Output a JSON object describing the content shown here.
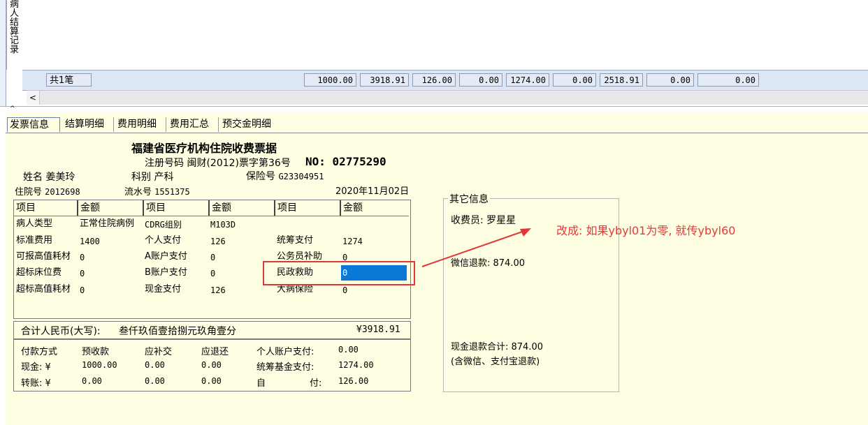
{
  "top_grid": {
    "side_label": "病人结算记录",
    "summary": {
      "count": "共1笔",
      "values": [
        "1000.00",
        "3918.91",
        "126.00",
        "0.00",
        "1274.00",
        "0.00",
        "2518.91",
        "0.00",
        "0.00"
      ]
    },
    "scroll_left_glyph": "<",
    "splitter_glyph": "^"
  },
  "tabs": [
    "发票信息",
    "结算明细",
    "费用明细",
    "费用汇总",
    "预交金明细"
  ],
  "receipt": {
    "title": "福建省医疗机构住院收费票据",
    "reg_line": "注册号码 闽财(2012)票字第36号",
    "no_label": "NO:",
    "no_value": "02775290",
    "name_label": "姓名",
    "name_value": "姜美玲",
    "dept_label": "科别",
    "dept_value": "产科",
    "insurance_label": "保险号",
    "insurance_value": "G23304951",
    "admission_label": "住院号",
    "admission_value": "2012698",
    "serial_label": "流水号",
    "serial_value": "1551375",
    "date": "2020年11月02日",
    "headers": [
      "项目",
      "金额",
      "项目",
      "金额",
      "项目",
      "金额"
    ],
    "rows": [
      [
        "病人类型",
        "正常住院病例",
        "CDRG组别",
        "M103D",
        "",
        ""
      ],
      [
        "标准费用",
        "1400",
        "个人支付",
        "126",
        "统筹支付",
        "1274"
      ],
      [
        "可报高值耗材",
        "0",
        "A账户支付",
        "0",
        "公务员补助",
        "0"
      ],
      [
        "超标床位费",
        "0",
        "B账户支付",
        "0",
        "民政救助",
        "0"
      ],
      [
        "超标高值耗材",
        "0",
        "现金支付",
        "126",
        "大病保险",
        "0"
      ]
    ],
    "total_label": "合计人民币(大写):",
    "total_words": "叁仟玖佰壹拾捌元玖角壹分",
    "total_amount": "¥3918.91",
    "pay": {
      "headers": [
        "付款方式",
        "预收款",
        "应补交",
        "应退还"
      ],
      "cash_label": "现金: ¥",
      "cash": [
        "1000.00",
        "0.00",
        "0.00"
      ],
      "transfer_label": "转账: ¥",
      "transfer": [
        "0.00",
        "0.00",
        "0.00"
      ],
      "personal_label": "个人账户支付:",
      "personal_value": "0.00",
      "pool_label": "统筹基金支付:",
      "pool_value": "1274.00",
      "self_label_a": "自",
      "self_label_b": "付:",
      "self_value": "126.00"
    }
  },
  "other_info": {
    "title": "其它信息",
    "cashier": "收费员: 罗星星",
    "wechat_refund": "微信退款: 874.00",
    "cash_refund_total": "现金退款合计: 874.00",
    "cash_refund_note": "(含微信、支付宝退款)"
  },
  "annotation": {
    "text": "改成: 如果ybyl01为零, 就传ybyl60",
    "color": "#e03a3a"
  },
  "colors": {
    "panel_bg": "#fefee2",
    "highlight": "#0a78d7",
    "grid_summary_bg": "#dce6f4"
  }
}
